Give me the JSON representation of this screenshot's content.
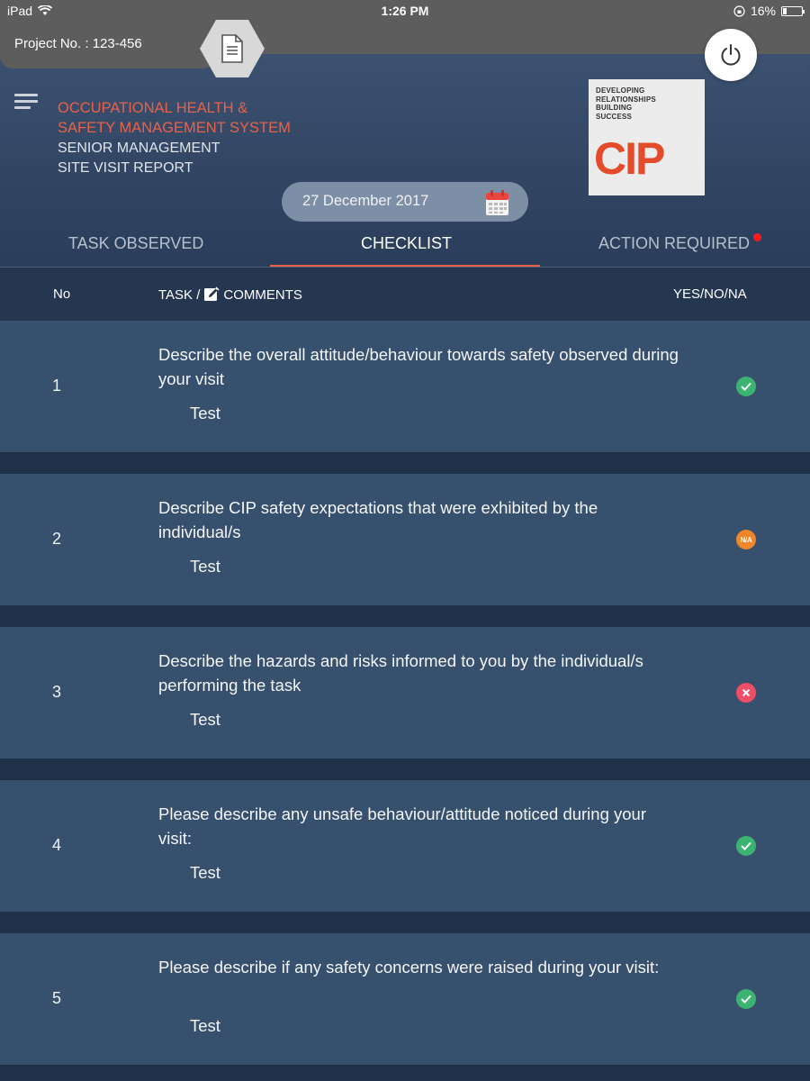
{
  "status_bar": {
    "device": "iPad",
    "time": "1:26 PM",
    "battery": "16%"
  },
  "project": {
    "label": "Project No. : 123-456"
  },
  "header": {
    "title_line1": "OCCUPATIONAL HEALTH &",
    "title_line2": "SAFETY MANAGEMENT SYSTEM",
    "subtitle_line1": "SENIOR MANAGEMENT",
    "subtitle_line2": "SITE VISIT REPORT",
    "date": "27 December 2017"
  },
  "logo": {
    "tagline_line1": "DEVELOPING",
    "tagline_line2": "RELATIONSHIPS",
    "tagline_line3": "BUILDING",
    "tagline_line4": "SUCCESS",
    "brand": "CIP"
  },
  "tabs": [
    {
      "label": "TASK OBSERVED"
    },
    {
      "label": "CHECKLIST"
    },
    {
      "label": "ACTION REQUIRED"
    }
  ],
  "columns": {
    "no": "No",
    "task_prefix": "TASK /",
    "task_suffix": "COMMENTS",
    "yes_no_na": "YES/NO/NA"
  },
  "rows": [
    {
      "no": "1",
      "question": "Describe the overall attitude/behaviour towards safety observed during  your visit",
      "comment": "Test",
      "status": "yes"
    },
    {
      "no": "2",
      "question": "Describe CIP safety expectations that were exhibited by the individual/s",
      "comment": "Test",
      "status": "na",
      "status_label": "N/A"
    },
    {
      "no": "3",
      "question": "Describe the hazards and risks informed to you by the individual/s performing the task",
      "comment": "Test",
      "status": "no"
    },
    {
      "no": "4",
      "question": "Please describe any unsafe behaviour/attitude noticed during your visit:",
      "comment": "Test",
      "status": "yes"
    },
    {
      "no": "5",
      "question": "Please describe if any safety concerns were raised during your visit:",
      "comment": "Test",
      "status": "yes"
    }
  ],
  "colors": {
    "accent": "#e8624a",
    "yes": "#3cb371",
    "na": "#f0862a",
    "no": "#ef4d68",
    "row_bg": "#37506d"
  }
}
